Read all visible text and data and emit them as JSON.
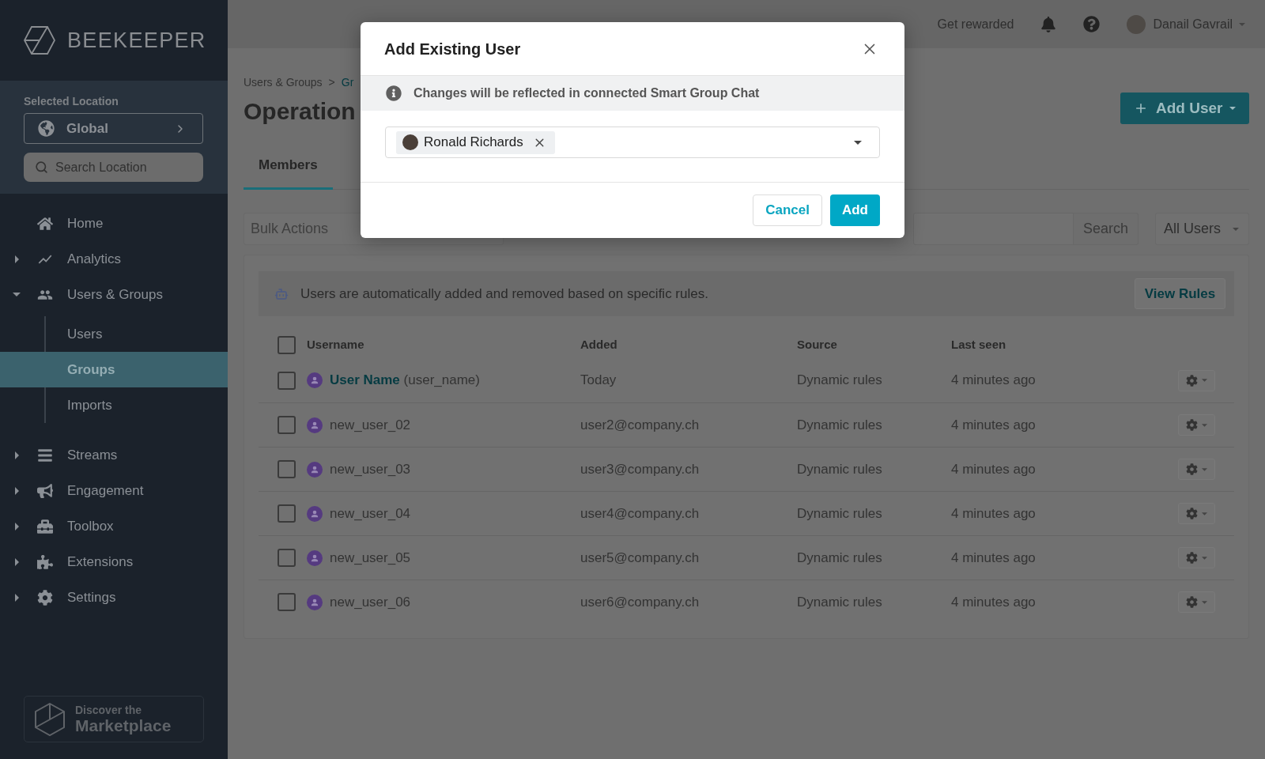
{
  "sidebar": {
    "logo": "BEEKEEPER",
    "location": {
      "label": "Selected Location",
      "value": "Global",
      "search_placeholder": "Search Location"
    },
    "nav": [
      {
        "label": "Home",
        "kind": "link",
        "selected": false
      },
      {
        "label": "Analytics",
        "kind": "section",
        "expanded": false,
        "selected": false
      },
      {
        "label": "Users & Groups",
        "kind": "section",
        "expanded": true,
        "selected": false,
        "children": [
          {
            "label": "Users",
            "selected": false
          },
          {
            "label": "Groups",
            "selected": true
          },
          {
            "label": "Imports",
            "selected": false
          }
        ]
      },
      {
        "label": "Streams",
        "kind": "section",
        "expanded": false,
        "selected": false
      },
      {
        "label": "Engagement",
        "kind": "section",
        "expanded": false,
        "selected": false
      },
      {
        "label": "Toolbox",
        "kind": "section",
        "expanded": false,
        "selected": false
      },
      {
        "label": "Extensions",
        "kind": "section",
        "expanded": false,
        "selected": false
      },
      {
        "label": "Settings",
        "kind": "section",
        "expanded": false,
        "selected": false
      }
    ],
    "marketplace": {
      "line_1": "Discover the",
      "line_2": "Marketplace"
    }
  },
  "top_bar": {
    "links": [
      "Get rewarded"
    ],
    "user_name": "Danail Gavrail"
  },
  "breadcrumb": {
    "items": [
      "Users & Groups",
      "Gr"
    ],
    "separator": ">"
  },
  "page_title": "Operation",
  "add_user_button": "Add User",
  "tabs": [
    {
      "label": "Members",
      "selected": true
    }
  ],
  "toolbar": {
    "bulk_actions_placeholder": "Bulk Actions",
    "search_button": "Search",
    "filter": "All Users"
  },
  "rules_notice": {
    "text": "Users are automatically added and removed based on specific rules.",
    "button": "View Rules"
  },
  "table": {
    "select_all_checked": false,
    "columns": [
      "Username",
      "Added",
      "Source",
      "Last seen"
    ],
    "rows": [
      {
        "display_name": "User Name",
        "username": "(user_name)",
        "checked": false,
        "added": "Today",
        "source": "Dynamic rules",
        "last_seen": "4 minutes ago"
      },
      {
        "username": "new_user_02",
        "checked": false,
        "added": "user2@company.ch",
        "source": "Dynamic rules",
        "last_seen": "4 minutes ago"
      },
      {
        "username": "new_user_03",
        "checked": false,
        "added": "user3@company.ch",
        "source": "Dynamic rules",
        "last_seen": "4 minutes ago"
      },
      {
        "username": "new_user_04",
        "checked": false,
        "added": "user4@company.ch",
        "source": "Dynamic rules",
        "last_seen": "4 minutes ago"
      },
      {
        "username": "new_user_05",
        "checked": false,
        "added": "user5@company.ch",
        "source": "Dynamic rules",
        "last_seen": "4 minutes ago"
      },
      {
        "username": "new_user_06",
        "checked": false,
        "added": "user6@company.ch",
        "source": "Dynamic rules",
        "last_seen": "4 minutes ago"
      }
    ]
  },
  "modal": {
    "title": "Add Existing User",
    "notice": "Changes will be reflected in connected Smart Group Chat",
    "selected_users": [
      {
        "name": "Ronald Richards"
      }
    ],
    "buttons": [
      {
        "label": "Cancel",
        "kind": "secondary"
      },
      {
        "label": "Add",
        "kind": "primary"
      }
    ]
  }
}
